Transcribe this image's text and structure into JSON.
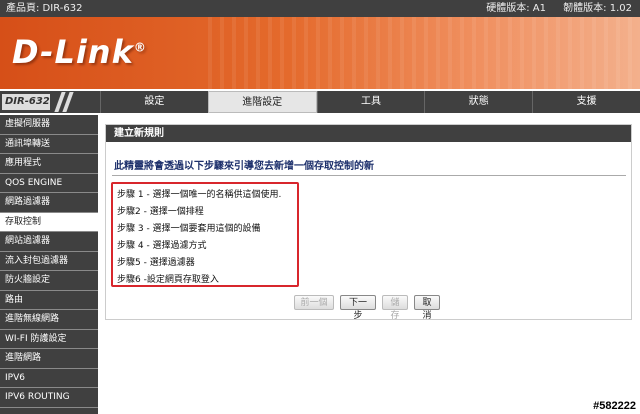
{
  "topbar": {
    "product_label": "產品頁: DIR-632",
    "hardware_version": "硬體版本: A1",
    "firmware_version": "韌體版本: 1.02"
  },
  "brand": {
    "logo_text": "D-Link",
    "logo_mark": "®"
  },
  "model_tag": "DIR-632",
  "tabs": [
    {
      "label": "設定"
    },
    {
      "label": "進階設定"
    },
    {
      "label": "工具"
    },
    {
      "label": "狀態"
    },
    {
      "label": "支援"
    }
  ],
  "sidebar": {
    "items": [
      {
        "label": "虛擬伺服器"
      },
      {
        "label": "通訊埠轉送"
      },
      {
        "label": "應用程式"
      },
      {
        "label": "QOS ENGINE"
      },
      {
        "label": "網路過濾器"
      },
      {
        "label": "存取控制"
      },
      {
        "label": "網站過濾器"
      },
      {
        "label": "流入封包過濾器"
      },
      {
        "label": "防火牆設定"
      },
      {
        "label": "路由"
      },
      {
        "label": "進階無線網路"
      },
      {
        "label": "WI-FI 防護設定"
      },
      {
        "label": "進階網路"
      },
      {
        "label": "IPV6"
      },
      {
        "label": "IPV6 ROUTING"
      }
    ]
  },
  "panel": {
    "title": "建立新規則",
    "intro": "此精靈將會透過以下步驟來引導您去新增一個存取控制的新",
    "steps": [
      "步驟 1 - 選擇一個唯一的名稱供這個使用.",
      "步驟2 - 選擇一個排程",
      "步驟 3 - 選擇一個要套用這個的設備",
      "步驟 4 - 選擇過濾方式",
      "步驟5 - 選擇過濾器",
      "步驟6 -設定網頁存取登入"
    ],
    "buttons": {
      "prev": "前一個",
      "next": "下一步",
      "save": "儲存",
      "cancel": "取消"
    }
  },
  "watermark": "#582222",
  "colors": {
    "accent_orange": "#e46a2c",
    "dark_bar": "#404040",
    "highlight_red": "#d8262c",
    "intro_blue": "#1c2f6b"
  }
}
